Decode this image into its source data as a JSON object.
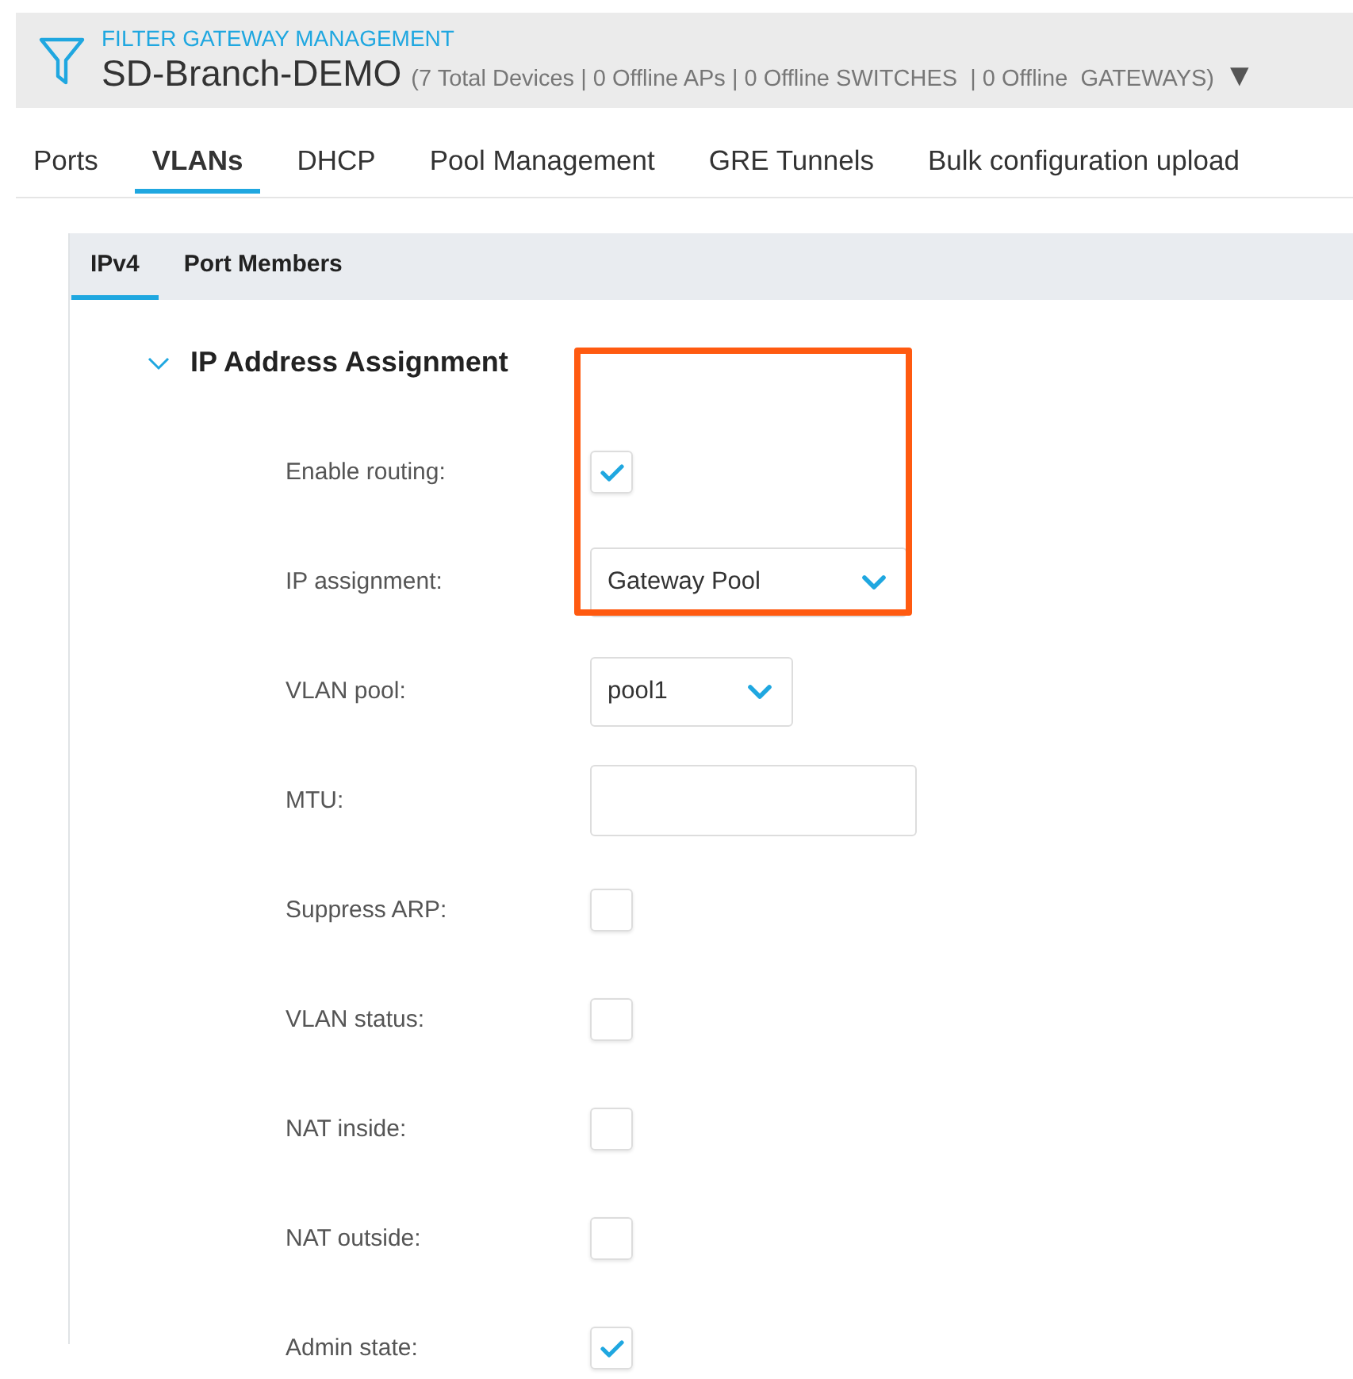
{
  "header": {
    "label": "FILTER GATEWAY MANAGEMENT",
    "title": "SD-Branch-DEMO",
    "summary": "(7 Total Devices | 0 Offline APs | 0 Offline SWITCHES  | 0 Offline  GATEWAYS)",
    "menu_arrow": "▼"
  },
  "tabs": [
    {
      "label": "Ports",
      "selected": false
    },
    {
      "label": "VLANs",
      "selected": true
    },
    {
      "label": "DHCP",
      "selected": false
    },
    {
      "label": "Pool Management",
      "selected": false
    },
    {
      "label": "GRE Tunnels",
      "selected": false
    },
    {
      "label": "Bulk configuration upload",
      "selected": false
    }
  ],
  "subtabs": [
    {
      "label": "IPv4",
      "selected": true
    },
    {
      "label": "Port Members",
      "selected": false
    }
  ],
  "section": {
    "title": "IP Address Assignment",
    "expanded": true
  },
  "annotation": {
    "kind": "highlight-box"
  },
  "fields": [
    {
      "kind": "checkbox",
      "label": "Enable routing:",
      "checked": true
    },
    {
      "kind": "select",
      "label": "IP assignment:",
      "value": "Gateway Pool"
    },
    {
      "kind": "select",
      "label": "VLAN pool:",
      "value": "pool1"
    },
    {
      "kind": "text",
      "label": "MTU:"
    },
    {
      "kind": "checkbox",
      "label": "Suppress ARP:",
      "checked": false
    },
    {
      "kind": "checkbox",
      "label": "VLAN status:",
      "checked": false
    },
    {
      "kind": "checkbox",
      "label": "NAT inside:",
      "checked": false
    },
    {
      "kind": "checkbox",
      "label": "NAT outside:",
      "checked": false
    },
    {
      "kind": "checkbox",
      "label": "Admin state:",
      "checked": true
    }
  ]
}
